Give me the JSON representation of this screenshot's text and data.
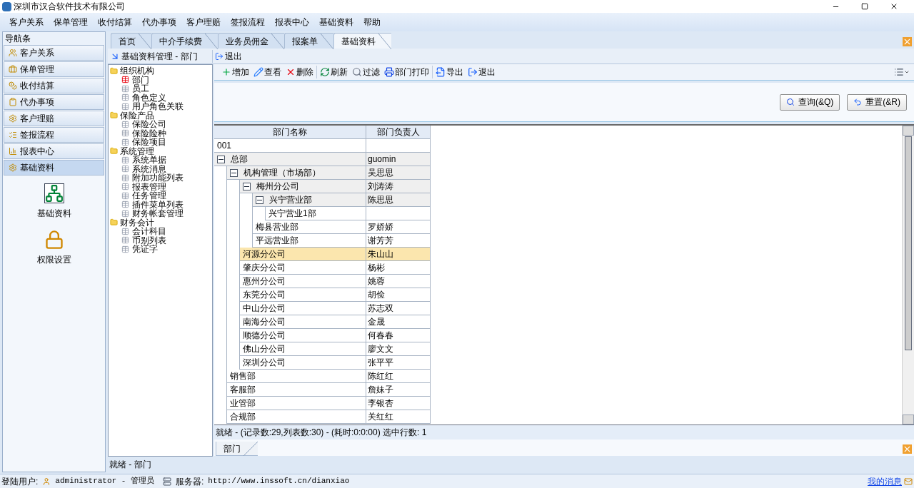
{
  "window": {
    "title": "深圳市汉合软件技术有限公司"
  },
  "menu": [
    "客户关系",
    "保单管理",
    "收付结算",
    "代办事项",
    "客户理赔",
    "签报流程",
    "报表中心",
    "基础资料",
    "帮助"
  ],
  "nav": {
    "title": "导航条",
    "items": [
      {
        "label": "客户关系",
        "selected": false
      },
      {
        "label": "保单管理",
        "selected": false
      },
      {
        "label": "收付结算",
        "selected": false
      },
      {
        "label": "代办事项",
        "selected": false
      },
      {
        "label": "客户理赔",
        "selected": false
      },
      {
        "label": "签报流程",
        "selected": false
      },
      {
        "label": "报表中心",
        "selected": false
      },
      {
        "label": "基础资料",
        "selected": true
      }
    ],
    "shortcuts": [
      "基础资料",
      "权限设置"
    ]
  },
  "tabs": [
    {
      "label": "首页",
      "selected": false
    },
    {
      "label": "中介手续费",
      "selected": false
    },
    {
      "label": "业务员佣金",
      "selected": false
    },
    {
      "label": "报案单",
      "selected": false
    },
    {
      "label": "基础资料",
      "selected": true
    }
  ],
  "subheader": {
    "title": "基础资料管理 - 部门",
    "exit": "退出"
  },
  "tree": [
    {
      "label": "组织机构",
      "children": [
        {
          "label": "部门",
          "selected": true
        },
        {
          "label": "员工",
          "selected": false
        },
        {
          "label": "角色定义",
          "selected": false
        },
        {
          "label": "用户角色关联",
          "selected": false
        }
      ]
    },
    {
      "label": "保险产品",
      "children": [
        {
          "label": "保险公司",
          "selected": false
        },
        {
          "label": "保险险种",
          "selected": false
        },
        {
          "label": "保险项目",
          "selected": false
        }
      ]
    },
    {
      "label": "系统管理",
      "children": [
        {
          "label": "系统单据",
          "selected": false
        },
        {
          "label": "系统消息",
          "selected": false
        },
        {
          "label": "附加功能列表",
          "selected": false
        },
        {
          "label": "报表管理",
          "selected": false
        },
        {
          "label": "任务管理",
          "selected": false
        },
        {
          "label": "插件菜单列表",
          "selected": false
        },
        {
          "label": "财务帐套管理",
          "selected": false
        }
      ]
    },
    {
      "label": "财务会计",
      "children": [
        {
          "label": "会计科目",
          "selected": false
        },
        {
          "label": "币别列表",
          "selected": false
        },
        {
          "label": "凭证字",
          "selected": false
        }
      ]
    }
  ],
  "toolbar": [
    [
      "增加",
      "查看",
      "删除"
    ],
    [
      "刷新",
      "过滤",
      "部门打印"
    ],
    [
      "导出",
      "退出"
    ]
  ],
  "filter": {
    "buttons": [
      "查询(&Q)",
      "重置(&R)"
    ]
  },
  "grid": {
    "columns": [
      "部门名称",
      "部门负责人"
    ],
    "rows": [
      {
        "name": "001",
        "selected": false
      },
      {
        "name": "总部",
        "manager": "guomin",
        "selected": false,
        "expanded": true,
        "children": [
          {
            "name": "机构管理（市场部）",
            "manager": "吴思思",
            "selected": false,
            "expanded": true,
            "children": [
              {
                "name": "梅州分公司",
                "manager": "刘涛涛",
                "selected": false,
                "expanded": true,
                "children": [
                  {
                    "name": "兴宁营业部",
                    "manager": "陈思思",
                    "selected": false,
                    "expanded": true,
                    "children": [
                      {
                        "name": "兴宁营业1部",
                        "selected": false
                      }
                    ]
                  },
                  {
                    "name": "梅县营业部",
                    "manager": "罗娇娇",
                    "selected": false
                  },
                  {
                    "name": "平远营业部",
                    "manager": "谢芳芳",
                    "selected": false
                  }
                ]
              },
              {
                "name": "河源分公司",
                "manager": "朱山山",
                "selected": true
              },
              {
                "name": "肇庆分公司",
                "manager": "杨彬",
                "selected": false
              },
              {
                "name": "惠州分公司",
                "manager": "姚蓉",
                "selected": false
              },
              {
                "name": "东莞分公司",
                "manager": "胡俭",
                "selected": false
              },
              {
                "name": "中山分公司",
                "manager": "苏志双",
                "selected": false
              },
              {
                "name": "南海分公司",
                "manager": "金晟",
                "selected": false
              },
              {
                "name": "顺德分公司",
                "manager": "何春春",
                "selected": false
              },
              {
                "name": "佛山分公司",
                "manager": "廖文文",
                "selected": false
              },
              {
                "name": "深圳分公司",
                "manager": "张平平",
                "selected": false
              }
            ]
          },
          {
            "name": "销售部",
            "manager": "陈红红",
            "selected": false
          },
          {
            "name": "客服部",
            "manager": "詹妹子",
            "selected": false
          },
          {
            "name": "业管部",
            "manager": "李银杏",
            "selected": false
          },
          {
            "name": "合规部",
            "manager": "关红红",
            "selected": false
          }
        ]
      }
    ]
  },
  "grid_status": "就绪 - (记录数:29,列表数:30) - (耗时:0:0:00) 选中行数: 1",
  "bottom_tabs": [
    {
      "label": "部门",
      "selected": true
    }
  ],
  "panel_status": "就绪 - 部门",
  "status_bar": {
    "user_label": "登陆用户:",
    "user": "administrator - 管理员",
    "server_label": "服务器:",
    "server": "http://www.inssoft.cn/dianxiao",
    "messages": "我的消息"
  }
}
